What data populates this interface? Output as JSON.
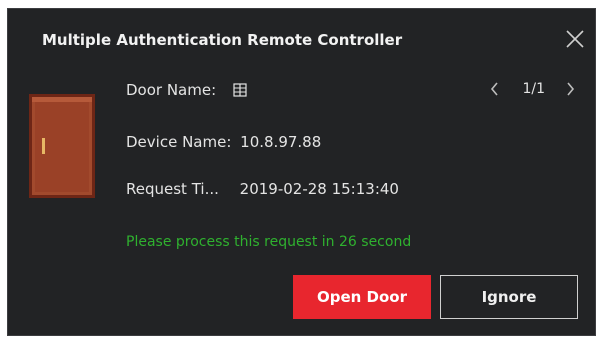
{
  "dialog": {
    "title": "Multiple Authentication Remote Controller",
    "close_icon": "close-icon"
  },
  "pager": {
    "prev_icon": "chevron-left-icon",
    "page_text": "1/1",
    "next_icon": "chevron-right-icon"
  },
  "fields": {
    "door_name_label": "Door Name:",
    "door_name_icon": "door-glyph-icon",
    "device_name_label": "Device Name:",
    "device_name_value": "10.8.97.88",
    "request_time_label": "Request Ti...",
    "request_time_value": "2019-02-28 15:13:40"
  },
  "notice": "Please process this request in 26 second",
  "buttons": {
    "open_door": "Open Door",
    "ignore": "Ignore"
  },
  "colors": {
    "background": "#222325",
    "accent_red": "#e8262e",
    "notice_green": "#2fb12f",
    "door_brown": "#a24a2d"
  },
  "icons": {
    "door": "door-icon"
  }
}
